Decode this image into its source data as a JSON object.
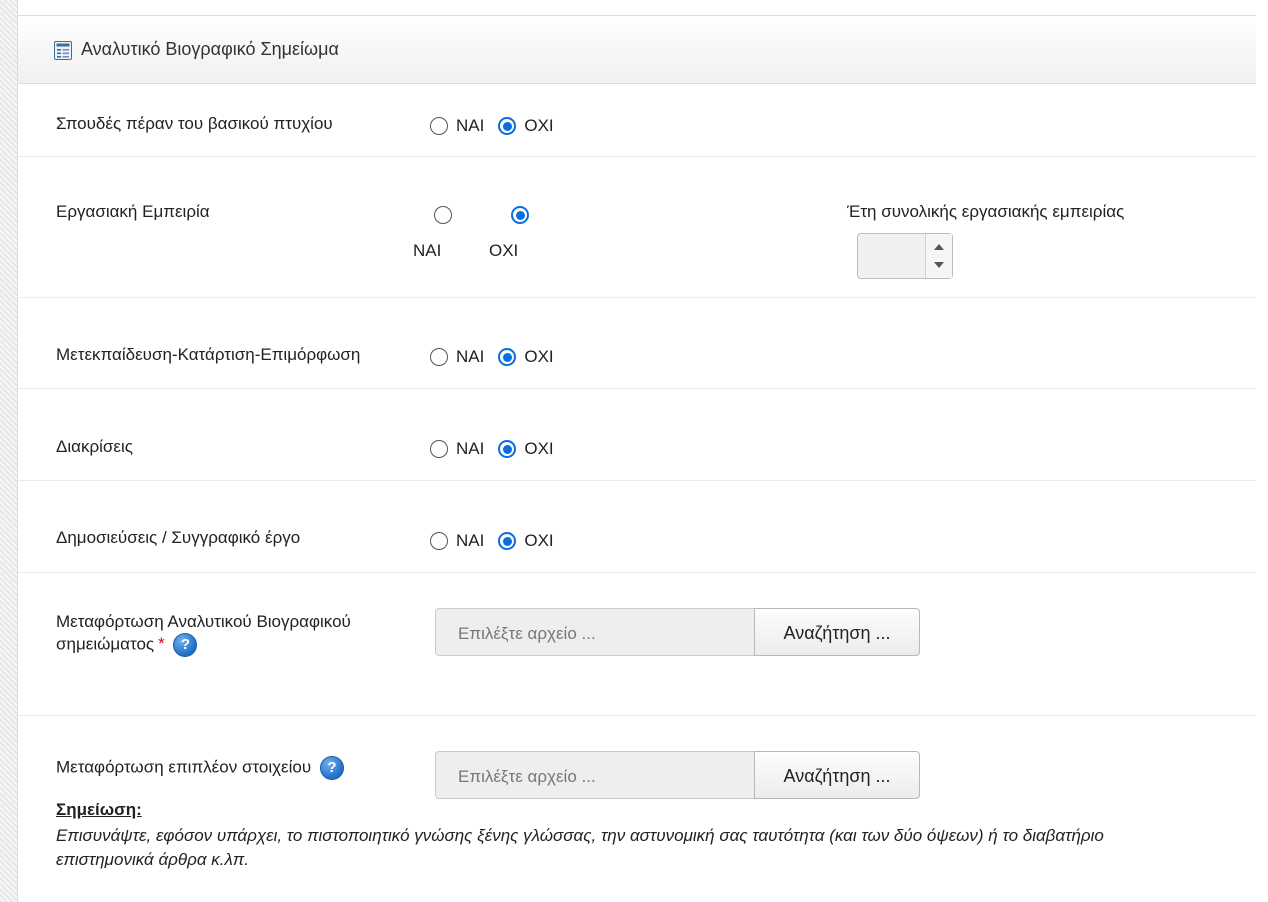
{
  "panel": {
    "title": "Αναλυτικό Βιογραφικό Σημείωμα"
  },
  "rows": {
    "studies": {
      "label": "Σπουδές πέραν του βασικού πτυχίου",
      "yes": "ΝΑΙ",
      "no": "ΟΧΙ",
      "selected": "no"
    },
    "experience": {
      "label": "Εργασιακή Εμπειρία",
      "yes": "ΝΑΙ",
      "no": "ΟΧΙ",
      "selected": "no",
      "years_label": "Έτη συνολικής εργασιακής εμπειρίας",
      "years_value": ""
    },
    "training": {
      "label": "Μετεκπαίδευση-Κατάρτιση-Επιμόρφωση",
      "yes": "ΝΑΙ",
      "no": "ΟΧΙ",
      "selected": "no"
    },
    "distinctions": {
      "label": "Διακρίσεις",
      "yes": "ΝΑΙ",
      "no": "ΟΧΙ",
      "selected": "no"
    },
    "publications": {
      "label": "Δημοσιεύσεις / Συγγραφικό έργο",
      "yes": "ΝΑΙ",
      "no": "ΟΧΙ",
      "selected": "no"
    }
  },
  "uploads": {
    "cv": {
      "label_line1": "Μεταφόρτωση Αναλυτικού Βιογραφικού",
      "label_line2": "σημειώματος",
      "required_mark": "*",
      "placeholder": "Επιλέξτε αρχείο ...",
      "button": "Αναζήτηση ..."
    },
    "extra": {
      "label": "Μεταφόρτωση επιπλέον στοιχείου",
      "placeholder": "Επιλέξτε αρχείο ...",
      "button": "Αναζήτηση ..."
    }
  },
  "note": {
    "title": "Σημείωση:",
    "line1": "Επισυνάψτε, εφόσον υπάρχει, το πιστοποιητικό γνώσης ξένης γλώσσας, την αστυνομική σας ταυτότητα (και των δύο όψεων) ή το διαβατήριο",
    "line2": "επιστημονικά άρθρα κ.λπ."
  },
  "icons": {
    "header": "document-list-icon",
    "help": "question-help-icon"
  },
  "colors": {
    "accent": "#0b6ee0",
    "required": "#d0021b",
    "help": "#1f6fc6"
  }
}
